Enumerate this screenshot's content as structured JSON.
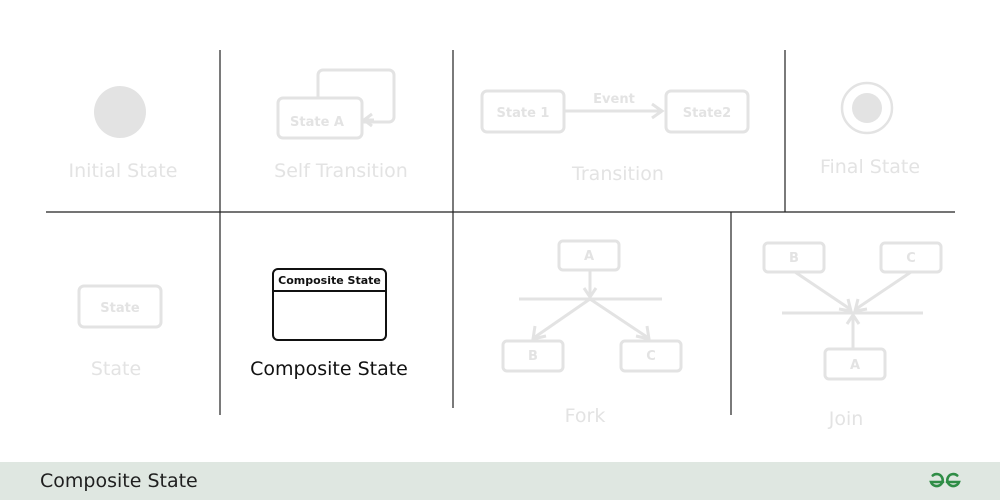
{
  "cells": {
    "initial_state": {
      "caption": "Initial State"
    },
    "self_transition": {
      "caption": "Self Transition",
      "box_label": "State A"
    },
    "transition": {
      "caption": "Transition",
      "from_label": "State 1",
      "to_label": "State2",
      "event_label": "Event"
    },
    "final_state": {
      "caption": "Final State"
    },
    "state": {
      "caption": "State",
      "box_label": "State"
    },
    "composite_state": {
      "caption": "Composite State",
      "box_label": "Composite State"
    },
    "fork": {
      "caption": "Fork",
      "top_label": "A",
      "left_label": "B",
      "right_label": "C"
    },
    "join": {
      "caption": "Join",
      "left_label": "B",
      "right_label": "C",
      "bottom_label": "A"
    }
  },
  "footer": {
    "title": "Composite State",
    "logo_icon": "geeksforgeeks-logo-icon"
  },
  "colors": {
    "faded": "#e3e3e3",
    "active": "#111111",
    "footer_bg": "#dfe7e1",
    "logo": "#2f8d46"
  }
}
